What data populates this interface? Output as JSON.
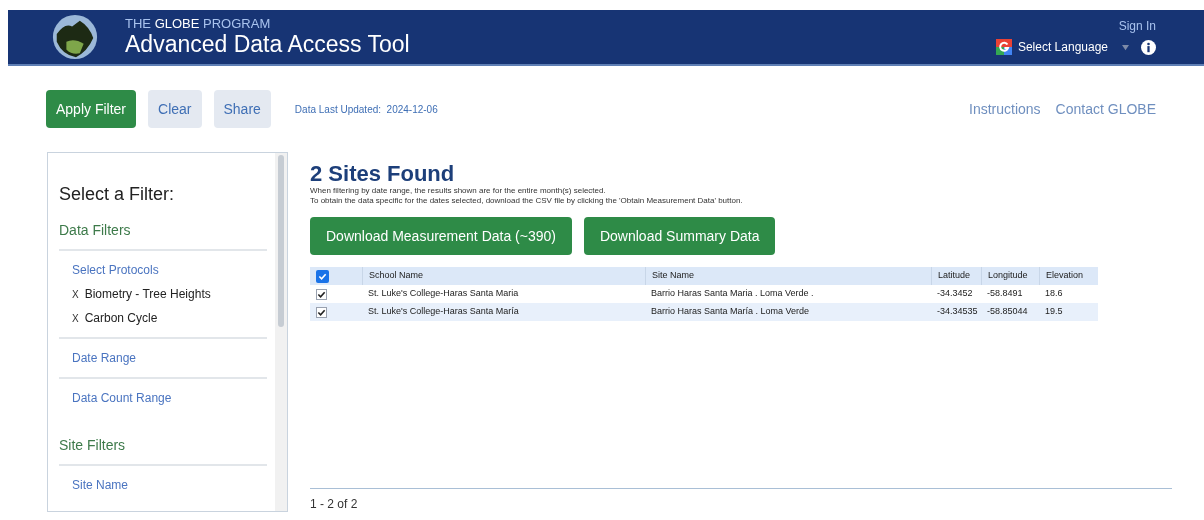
{
  "header": {
    "program_prefix": "THE",
    "program_name": "GLOBE",
    "program_suffix": "PROGRAM",
    "title": "Advanced Data Access Tool",
    "sign_in": "Sign In",
    "language": "Select Language"
  },
  "toolbar": {
    "buttons": [
      {
        "label": "Apply Filter",
        "kind": "primary"
      },
      {
        "label": "Clear",
        "kind": "secondary"
      },
      {
        "label": "Share",
        "kind": "secondary"
      }
    ],
    "updated_label": "Data Last Updated:",
    "updated_value": "2024-12-06",
    "links": [
      "Instructions",
      "Contact GLOBE"
    ]
  },
  "sidebar": {
    "title": "Select a Filter:",
    "sections": [
      {
        "heading": "Data Filters",
        "items": [
          {
            "label": "Select Protocols",
            "chips": [
              {
                "remove": "X",
                "label": "Biometry - Tree Heights"
              },
              {
                "remove": "X",
                "label": "Carbon Cycle"
              }
            ]
          },
          {
            "label": "Date Range"
          },
          {
            "label": "Data Count Range"
          }
        ]
      },
      {
        "heading": "Site Filters",
        "items": [
          {
            "label": "Site Name"
          }
        ]
      }
    ]
  },
  "results": {
    "heading": "2 Sites Found",
    "notes": [
      "When filtering by date range, the results shown are for the entire month(s) selected.",
      "To obtain the data specific for the dates selected, download the CSV file by clicking the 'Obtain Measurement Data' button."
    ],
    "buttons": [
      "Download Measurement Data (~390)",
      "Download Summary Data"
    ],
    "table": {
      "select_all": {
        "checked": true
      },
      "columns": [
        "School Name",
        "Site Name",
        "Latitude",
        "Longitude",
        "Elevation"
      ],
      "rows": [
        {
          "checked": true,
          "cells": [
            "St. Luke's College-Haras Santa Maria",
            "Barrio Haras Santa Maria . Loma Verde .",
            "-34.3452",
            "-58.8491",
            "18.6"
          ]
        },
        {
          "checked": true,
          "cells": [
            "St. Luke's College-Haras Santa María",
            "Barrio Haras Santa María . Loma Verde",
            "-34.34535",
            "-58.85044",
            "19.5"
          ]
        }
      ]
    },
    "pagination": "1 - 2 of 2"
  }
}
